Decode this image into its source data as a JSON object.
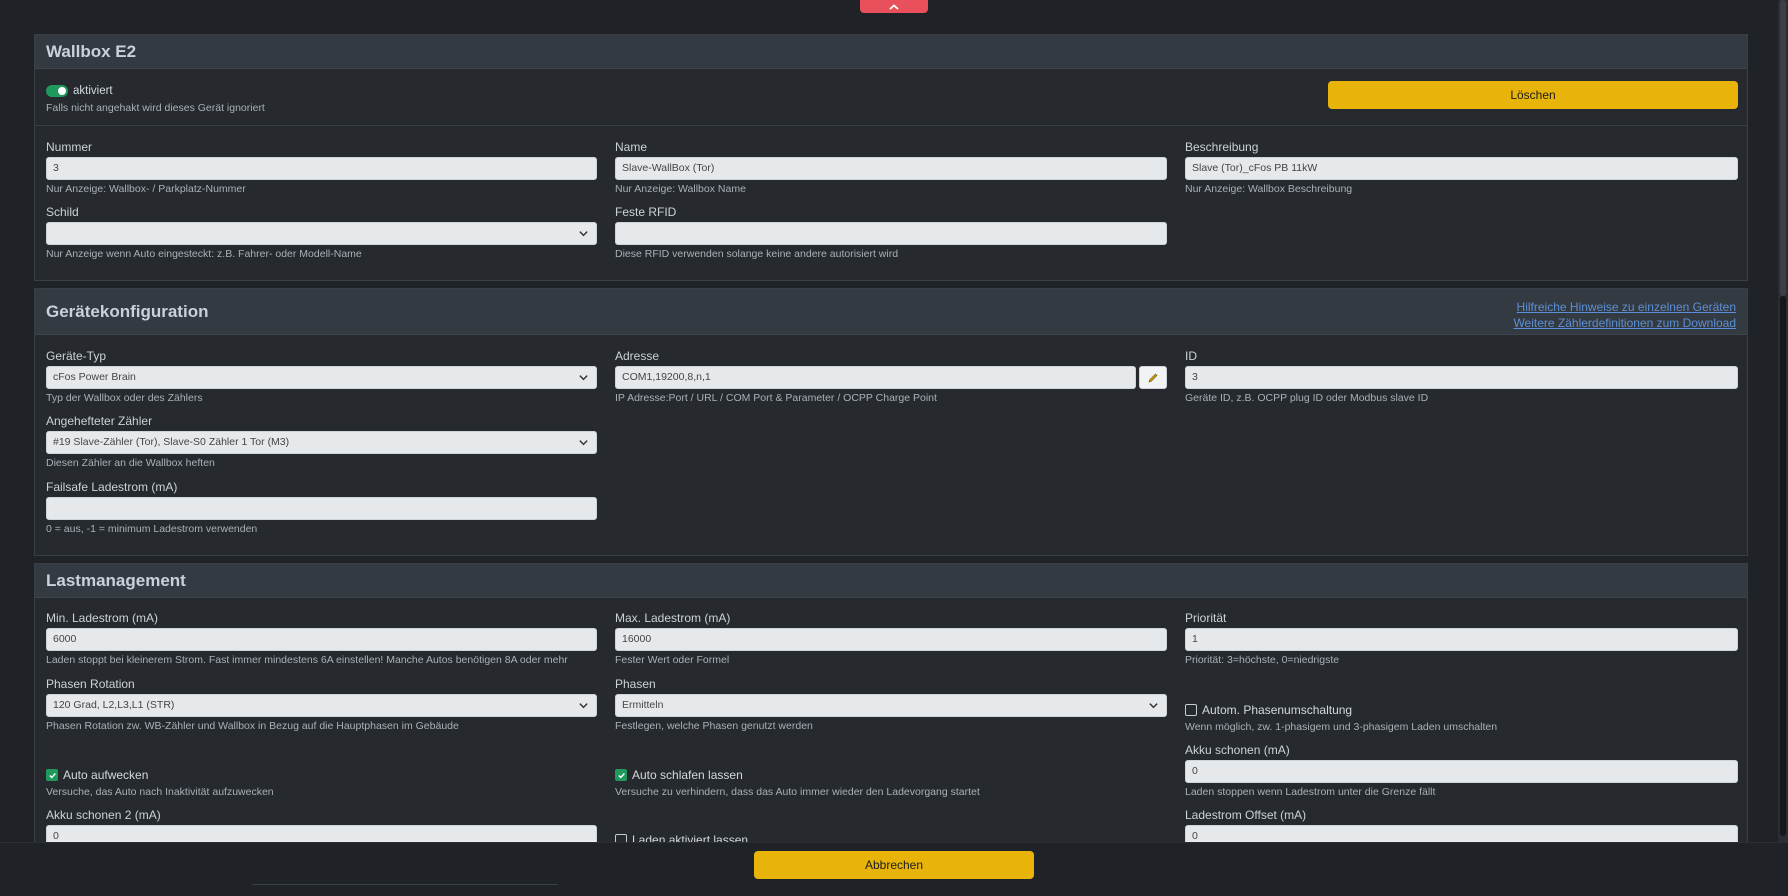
{
  "wallbox": {
    "title": "Wallbox E2",
    "active_label": "aktiviert",
    "active_hint": "Falls nicht angehakt wird dieses Gerät ignoriert",
    "delete_label": "Löschen",
    "nummer": {
      "label": "Nummer",
      "value": "3",
      "hint": "Nur Anzeige: Wallbox- / Parkplatz-Nummer"
    },
    "name": {
      "label": "Name",
      "value": "Slave-WallBox (Tor)",
      "hint": "Nur Anzeige: Wallbox Name"
    },
    "beschreibung": {
      "label": "Beschreibung",
      "value": "Slave (Tor)_cFos PB 11kW",
      "hint": "Nur Anzeige: Wallbox Beschreibung"
    },
    "schild": {
      "label": "Schild",
      "value": "",
      "hint": "Nur Anzeige wenn Auto eingesteckt: z.B. Fahrer- oder Modell-Name"
    },
    "rfid": {
      "label": "Feste RFID",
      "value": "",
      "hint": "Diese RFID verwenden solange keine andere autorisiert wird"
    }
  },
  "geraet": {
    "title": "Gerätekonfiguration",
    "link1": "Hilfreiche Hinweise zu einzelnen Geräten",
    "link2": "Weitere Zählerdefinitionen zum Download",
    "typ": {
      "label": "Geräte-Typ",
      "value": "cFos Power Brain",
      "hint": "Typ der Wallbox oder des Zählers"
    },
    "adresse": {
      "label": "Adresse",
      "value": "COM1,19200,8,n,1",
      "hint": "IP Adresse:Port / URL / COM Port & Parameter / OCPP Charge Point"
    },
    "id": {
      "label": "ID",
      "value": "3",
      "hint": "Geräte ID, z.B. OCPP plug ID oder Modbus slave ID"
    },
    "zaehler": {
      "label": "Angehefteter Zähler",
      "value": "#19 Slave-Zähler (Tor), Slave-S0 Zähler 1 Tor (M3)",
      "hint": "Diesen Zähler an die Wallbox heften"
    },
    "failsafe": {
      "label": "Failsafe Ladestrom (mA)",
      "value": "",
      "hint": "0 = aus, -1 = minimum Ladestrom verwenden"
    }
  },
  "last": {
    "title": "Lastmanagement",
    "min": {
      "label": "Min. Ladestrom (mA)",
      "value": "6000",
      "hint": "Laden stoppt bei kleinerem Strom. Fast immer mindestens 6A einstellen! Manche Autos benötigen 8A oder mehr"
    },
    "max": {
      "label": "Max. Ladestrom (mA)",
      "value": "16000",
      "hint": "Fester Wert oder Formel"
    },
    "prio": {
      "label": "Priorität",
      "value": "1",
      "hint": "Priorität: 3=höchste, 0=niedrigste"
    },
    "rotation": {
      "label": "Phasen Rotation",
      "value": "120 Grad, L2,L3,L1 (STR)",
      "hint": "Phasen Rotation zw. WB-Zähler und Wallbox in Bezug auf die Hauptphasen im Gebäude"
    },
    "phasen": {
      "label": "Phasen",
      "value": "Ermitteln",
      "hint": "Festlegen, welche Phasen genutzt werden"
    },
    "umschaltung": {
      "label": "Autom. Phasenumschaltung",
      "hint": "Wenn möglich, zw. 1-phasigem und 3-phasigem Laden umschalten"
    },
    "aufwecken": {
      "label": "Auto aufwecken",
      "hint": "Versuche, das Auto nach Inaktivität aufzuwecken"
    },
    "schlafen": {
      "label": "Auto schlafen lassen",
      "hint": "Versuche zu verhindern, dass das Auto immer wieder den Ladevorgang startet"
    },
    "akku": {
      "label": "Akku schonen (mA)",
      "value": "0",
      "hint": "Laden stoppen wenn Ladestrom unter die Grenze fällt"
    },
    "akku2": {
      "label": "Akku schonen 2 (mA)",
      "value": "0"
    },
    "aktiviert": {
      "label": "Laden aktiviert lassen"
    },
    "offset": {
      "label": "Ladestrom Offset (mA)",
      "value": "0"
    }
  },
  "footer": {
    "cancel_label": "Abbrechen"
  },
  "colors": {
    "accent_yellow": "#e9b40a",
    "toggle_green": "#1f9a5c",
    "link_blue": "#5c8fd6",
    "top_tab_red": "#e8505b"
  }
}
